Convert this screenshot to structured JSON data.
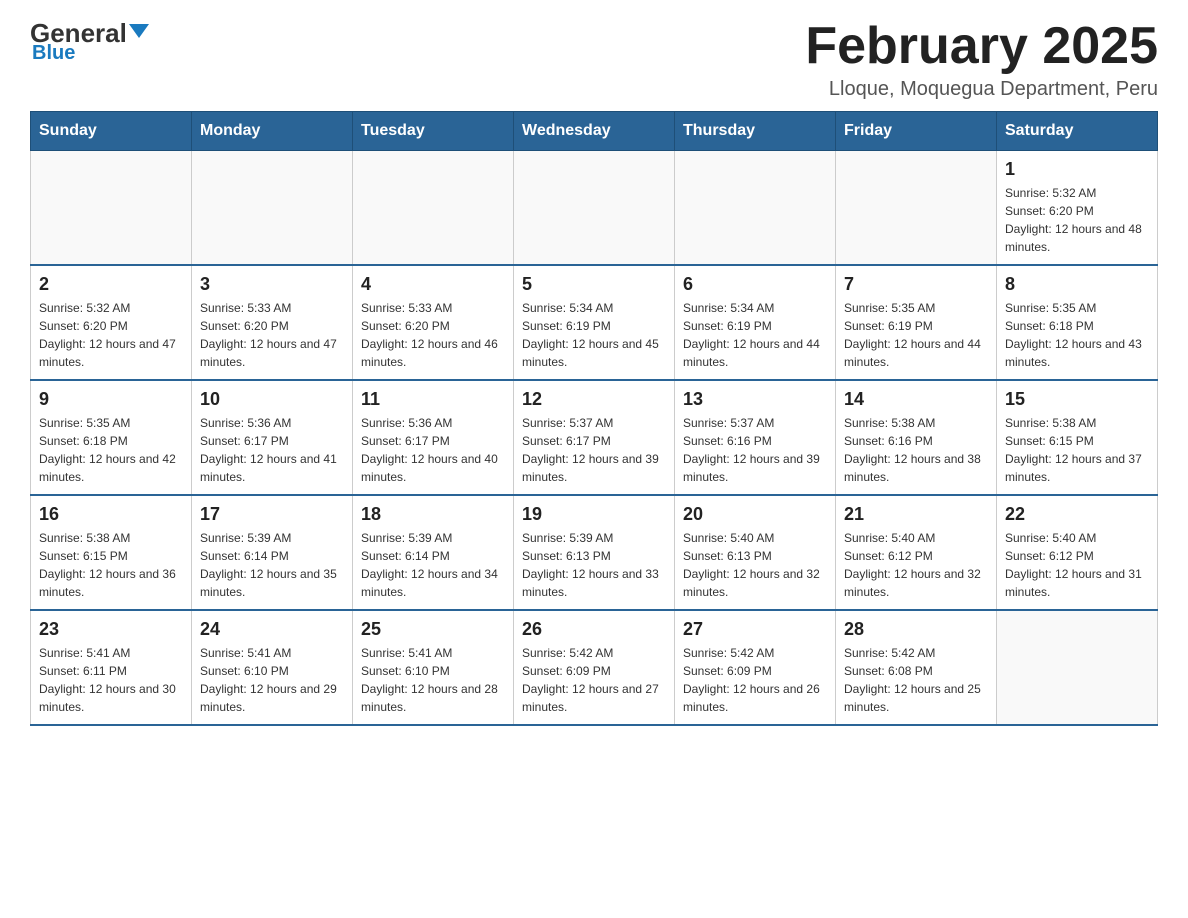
{
  "logo": {
    "general": "General",
    "triangle": "▼",
    "blue": "Blue"
  },
  "header": {
    "month_year": "February 2025",
    "location": "Lloque, Moquegua Department, Peru"
  },
  "weekdays": [
    "Sunday",
    "Monday",
    "Tuesday",
    "Wednesday",
    "Thursday",
    "Friday",
    "Saturday"
  ],
  "weeks": [
    [
      {
        "day": "",
        "info": ""
      },
      {
        "day": "",
        "info": ""
      },
      {
        "day": "",
        "info": ""
      },
      {
        "day": "",
        "info": ""
      },
      {
        "day": "",
        "info": ""
      },
      {
        "day": "",
        "info": ""
      },
      {
        "day": "1",
        "info": "Sunrise: 5:32 AM\nSunset: 6:20 PM\nDaylight: 12 hours and 48 minutes."
      }
    ],
    [
      {
        "day": "2",
        "info": "Sunrise: 5:32 AM\nSunset: 6:20 PM\nDaylight: 12 hours and 47 minutes."
      },
      {
        "day": "3",
        "info": "Sunrise: 5:33 AM\nSunset: 6:20 PM\nDaylight: 12 hours and 47 minutes."
      },
      {
        "day": "4",
        "info": "Sunrise: 5:33 AM\nSunset: 6:20 PM\nDaylight: 12 hours and 46 minutes."
      },
      {
        "day": "5",
        "info": "Sunrise: 5:34 AM\nSunset: 6:19 PM\nDaylight: 12 hours and 45 minutes."
      },
      {
        "day": "6",
        "info": "Sunrise: 5:34 AM\nSunset: 6:19 PM\nDaylight: 12 hours and 44 minutes."
      },
      {
        "day": "7",
        "info": "Sunrise: 5:35 AM\nSunset: 6:19 PM\nDaylight: 12 hours and 44 minutes."
      },
      {
        "day": "8",
        "info": "Sunrise: 5:35 AM\nSunset: 6:18 PM\nDaylight: 12 hours and 43 minutes."
      }
    ],
    [
      {
        "day": "9",
        "info": "Sunrise: 5:35 AM\nSunset: 6:18 PM\nDaylight: 12 hours and 42 minutes."
      },
      {
        "day": "10",
        "info": "Sunrise: 5:36 AM\nSunset: 6:17 PM\nDaylight: 12 hours and 41 minutes."
      },
      {
        "day": "11",
        "info": "Sunrise: 5:36 AM\nSunset: 6:17 PM\nDaylight: 12 hours and 40 minutes."
      },
      {
        "day": "12",
        "info": "Sunrise: 5:37 AM\nSunset: 6:17 PM\nDaylight: 12 hours and 39 minutes."
      },
      {
        "day": "13",
        "info": "Sunrise: 5:37 AM\nSunset: 6:16 PM\nDaylight: 12 hours and 39 minutes."
      },
      {
        "day": "14",
        "info": "Sunrise: 5:38 AM\nSunset: 6:16 PM\nDaylight: 12 hours and 38 minutes."
      },
      {
        "day": "15",
        "info": "Sunrise: 5:38 AM\nSunset: 6:15 PM\nDaylight: 12 hours and 37 minutes."
      }
    ],
    [
      {
        "day": "16",
        "info": "Sunrise: 5:38 AM\nSunset: 6:15 PM\nDaylight: 12 hours and 36 minutes."
      },
      {
        "day": "17",
        "info": "Sunrise: 5:39 AM\nSunset: 6:14 PM\nDaylight: 12 hours and 35 minutes."
      },
      {
        "day": "18",
        "info": "Sunrise: 5:39 AM\nSunset: 6:14 PM\nDaylight: 12 hours and 34 minutes."
      },
      {
        "day": "19",
        "info": "Sunrise: 5:39 AM\nSunset: 6:13 PM\nDaylight: 12 hours and 33 minutes."
      },
      {
        "day": "20",
        "info": "Sunrise: 5:40 AM\nSunset: 6:13 PM\nDaylight: 12 hours and 32 minutes."
      },
      {
        "day": "21",
        "info": "Sunrise: 5:40 AM\nSunset: 6:12 PM\nDaylight: 12 hours and 32 minutes."
      },
      {
        "day": "22",
        "info": "Sunrise: 5:40 AM\nSunset: 6:12 PM\nDaylight: 12 hours and 31 minutes."
      }
    ],
    [
      {
        "day": "23",
        "info": "Sunrise: 5:41 AM\nSunset: 6:11 PM\nDaylight: 12 hours and 30 minutes."
      },
      {
        "day": "24",
        "info": "Sunrise: 5:41 AM\nSunset: 6:10 PM\nDaylight: 12 hours and 29 minutes."
      },
      {
        "day": "25",
        "info": "Sunrise: 5:41 AM\nSunset: 6:10 PM\nDaylight: 12 hours and 28 minutes."
      },
      {
        "day": "26",
        "info": "Sunrise: 5:42 AM\nSunset: 6:09 PM\nDaylight: 12 hours and 27 minutes."
      },
      {
        "day": "27",
        "info": "Sunrise: 5:42 AM\nSunset: 6:09 PM\nDaylight: 12 hours and 26 minutes."
      },
      {
        "day": "28",
        "info": "Sunrise: 5:42 AM\nSunset: 6:08 PM\nDaylight: 12 hours and 25 minutes."
      },
      {
        "day": "",
        "info": ""
      }
    ]
  ]
}
